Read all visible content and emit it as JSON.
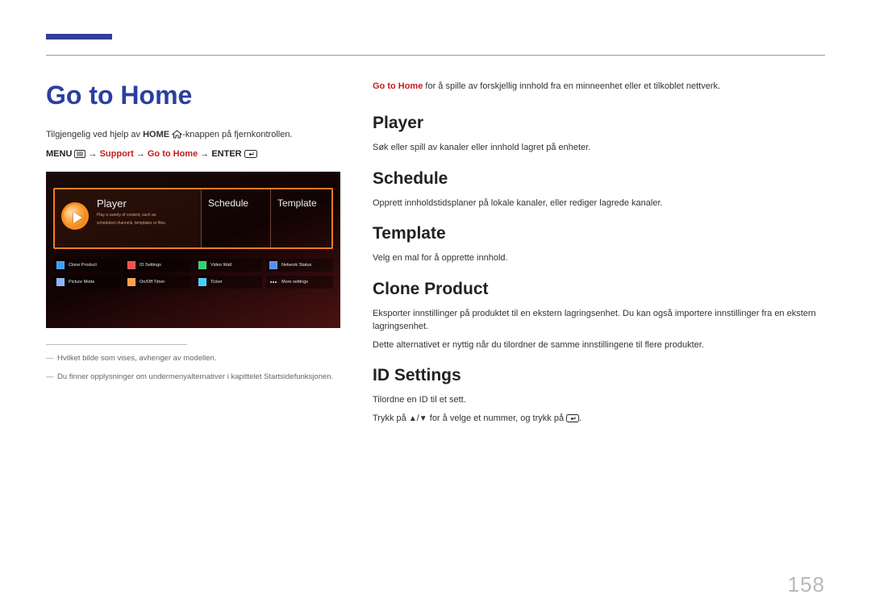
{
  "page": {
    "title": "Go to Home",
    "number": "158"
  },
  "left": {
    "intro_pre": "Tilgjengelig ved hjelp av ",
    "intro_home": "HOME",
    "intro_post": "-knappen på fjernkontrollen.",
    "menu_path": {
      "menu": "MENU",
      "support": "Support",
      "go_home": "Go to Home",
      "enter": "ENTER"
    },
    "screenshot": {
      "tiles": {
        "player": "Player",
        "player_sub1": "Play a variety of content, such as",
        "player_sub2": "scheduled channels, templates or files.",
        "schedule": "Schedule",
        "template": "Template"
      },
      "small_row1": [
        "Clone Product",
        "ID Settings",
        "Video Wall",
        "Network Status"
      ],
      "small_row2": [
        "Picture Mode",
        "On/Off Timer",
        "Ticker",
        "More settings"
      ]
    },
    "footnotes": [
      "Hvilket bilde som vises, avhenger av modellen.",
      "Du finner opplysninger om undermenyalternativer i kapittelet Startsidefunksjonen."
    ]
  },
  "right": {
    "lead_bold": "Go to Home",
    "lead_rest": " for å spille av forskjellig innhold fra en minneenhet eller et tilkoblet nettverk.",
    "sections": [
      {
        "h": "Player",
        "p": [
          "Søk eller spill av kanaler eller innhold lagret på enheter."
        ]
      },
      {
        "h": "Schedule",
        "p": [
          "Opprett innholdstidsplaner på lokale kanaler, eller rediger lagrede kanaler."
        ]
      },
      {
        "h": "Template",
        "p": [
          "Velg en mal for å opprette innhold."
        ]
      },
      {
        "h": "Clone Product",
        "p": [
          "Eksporter innstillinger på produktet til en ekstern lagringsenhet. Du kan også importere innstillinger fra en ekstern lagringsenhet.",
          "Dette alternativet er nyttig når du tilordner de samme innstillingene til flere produkter."
        ]
      },
      {
        "h": "ID Settings",
        "p": [
          "Tilordne en ID til et sett.",
          "Trykk på ▲/▼ for å velge et nummer, og trykk på ⏎."
        ]
      }
    ]
  }
}
